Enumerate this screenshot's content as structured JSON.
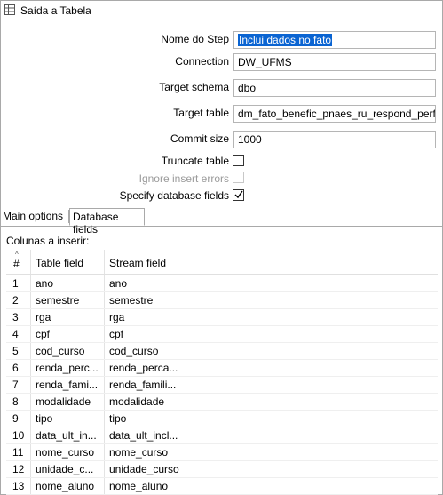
{
  "window": {
    "title": "Saída a Tabela"
  },
  "form": {
    "step_name_label": "Nome do Step",
    "step_name_value": "Inclui dados no fato",
    "connection_label": "Connection",
    "connection_value": "DW_UFMS",
    "schema_label": "Target schema",
    "schema_value": "dbo",
    "table_label": "Target table",
    "table_value": "dm_fato_benefic_pnaes_ru_respond_perfil",
    "commit_label": "Commit size",
    "commit_value": "1000",
    "truncate_label": "Truncate table",
    "truncate_checked": false,
    "ignore_errors_label": "Ignore insert errors",
    "ignore_errors_checked": false,
    "specify_fields_label": "Specify database fields",
    "specify_fields_checked": true
  },
  "tabs": [
    {
      "label": "Main options",
      "active": false
    },
    {
      "label": "Database fields",
      "active": true
    }
  ],
  "fields_panel": {
    "label": "Colunas a inserir:",
    "columns": [
      "#",
      "Table field",
      "Stream field"
    ],
    "rows": [
      {
        "n": "1",
        "table": "ano",
        "stream": "ano"
      },
      {
        "n": "2",
        "table": "semestre",
        "stream": "semestre"
      },
      {
        "n": "3",
        "table": "rga",
        "stream": "rga"
      },
      {
        "n": "4",
        "table": "cpf",
        "stream": "cpf"
      },
      {
        "n": "5",
        "table": "cod_curso",
        "stream": "cod_curso"
      },
      {
        "n": "6",
        "table": "renda_perc...",
        "stream": "renda_perca..."
      },
      {
        "n": "7",
        "table": "renda_fami...",
        "stream": "renda_famili..."
      },
      {
        "n": "8",
        "table": "modalidade",
        "stream": "modalidade"
      },
      {
        "n": "9",
        "table": "tipo",
        "stream": "tipo"
      },
      {
        "n": "10",
        "table": "data_ult_in...",
        "stream": "data_ult_incl..."
      },
      {
        "n": "11",
        "table": "nome_curso",
        "stream": "nome_curso"
      },
      {
        "n": "12",
        "table": "unidade_c...",
        "stream": "unidade_curso"
      },
      {
        "n": "13",
        "table": "nome_aluno",
        "stream": "nome_aluno"
      }
    ]
  },
  "icons": {
    "title": "table-icon",
    "sort": "sort-up-icon",
    "check": "check-icon"
  },
  "colors": {
    "selection": "#0a64d2",
    "border": "#a9a9a9",
    "disabled_text": "#9a9a9a"
  }
}
